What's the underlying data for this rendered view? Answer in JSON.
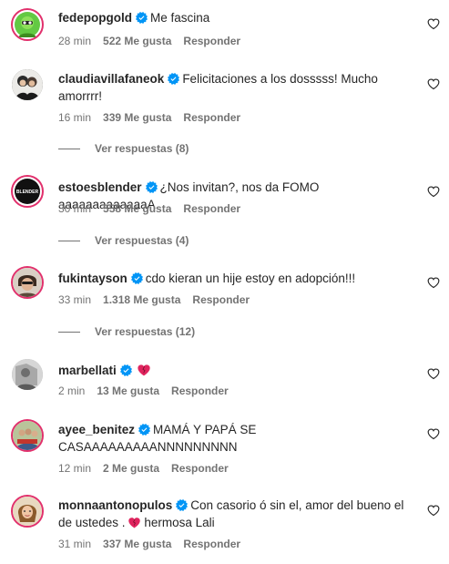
{
  "comments": [
    {
      "username": "fedepopgold",
      "text": "Me fascina",
      "time": "28 min",
      "likes": "522 Me gusta",
      "reply_label": "Responder",
      "avatar_icon": "green-cartoon-avatar",
      "avatar_color": "#63c943"
    },
    {
      "username": "claudiavillafaneok",
      "text": "Felicitaciones a los dosssss! Mucho amorrrr!",
      "time": "16 min",
      "likes": "339 Me gusta",
      "reply_label": "Responder",
      "view_replies": "Ver respuestas (8)",
      "avatar_icon": "couple-photo-avatar",
      "avatar_color": "#3a3a3a"
    },
    {
      "username": "estoesblender",
      "text": "¿Nos invitan?, nos da FOMO aaaaaaaaaaaaaA",
      "time": "30 min",
      "likes": "558 Me gusta",
      "reply_label": "Responder",
      "view_replies": "Ver respuestas (4)",
      "avatar_icon": "blender-logo-avatar",
      "avatar_color": "#111111"
    },
    {
      "username": "fukintayson",
      "text": "cdo kieran un hije estoy en adopción!!!",
      "time": "33 min",
      "likes": "1.318 Me gusta",
      "reply_label": "Responder",
      "view_replies": "Ver respuestas (12)",
      "avatar_icon": "person-photo-avatar",
      "avatar_color": "#8a6a55"
    },
    {
      "username": "marbellati",
      "text": "",
      "time": "2 min",
      "likes": "13 Me gusta",
      "reply_label": "Responder",
      "avatar_icon": "grey-photo-avatar",
      "avatar_color": "#9a9a9a"
    },
    {
      "username": "ayee_benitez",
      "text": "MAMÁ Y PAPÁ SE CASAAAAAAAAANNNNNNNNN",
      "time": "12 min",
      "likes": "2 Me gusta",
      "reply_label": "Responder",
      "avatar_icon": "group-photo-avatar",
      "avatar_color": "#6b7a3c"
    },
    {
      "username": "monnaantonopulos",
      "text": "Con casorio ó sin el, amor del bueno el de ustedes .",
      "text_suffix": " hermosa Lali",
      "time": "31 min",
      "likes": "337 Me gusta",
      "reply_label": "Responder",
      "avatar_icon": "woman-photo-avatar",
      "avatar_color": "#c29a6b"
    }
  ],
  "colors": {
    "verified_blue": "#0095f6",
    "meta_grey": "#737373",
    "heart_red": "#e0245e"
  }
}
